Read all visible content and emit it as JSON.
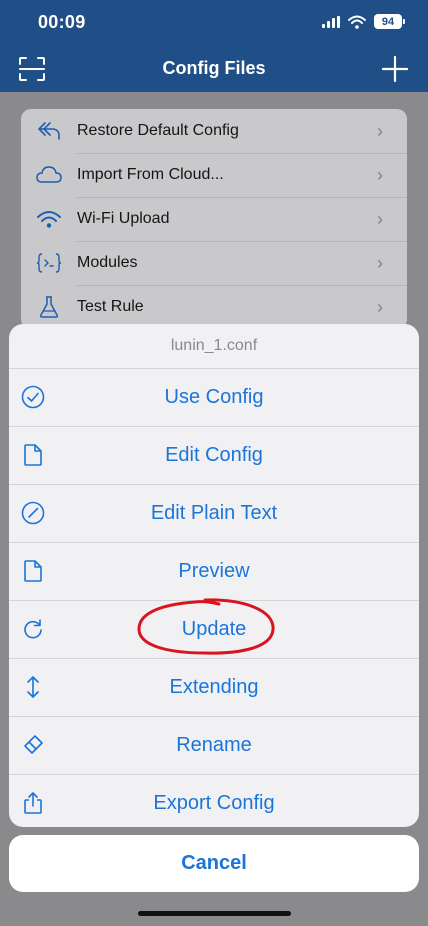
{
  "status_bar": {
    "time": "00:09",
    "battery": "94"
  },
  "header": {
    "title": "Config Files",
    "left_icon": "scan-icon",
    "right_icon": "plus-icon"
  },
  "background_list": {
    "items": [
      {
        "label": "Restore Default Config",
        "icon": "undo-arrow-icon"
      },
      {
        "label": "Import From Cloud...",
        "icon": "cloud-icon"
      },
      {
        "label": "Wi-Fi Upload",
        "icon": "wifi-icon"
      },
      {
        "label": "Modules",
        "icon": "code-braces-icon"
      },
      {
        "label": "Test Rule",
        "icon": "flask-icon"
      }
    ]
  },
  "action_sheet": {
    "title": "lunin_1.conf",
    "actions": [
      {
        "label": "Use Config",
        "icon": "checkmark-circle-icon"
      },
      {
        "label": "Edit Config",
        "icon": "document-icon"
      },
      {
        "label": "Edit Plain Text",
        "icon": "pencil-circle-icon"
      },
      {
        "label": "Preview",
        "icon": "document-icon"
      },
      {
        "label": "Update",
        "icon": "refresh-icon"
      },
      {
        "label": "Extending",
        "icon": "up-down-arrows-icon"
      },
      {
        "label": "Rename",
        "icon": "eraser-icon"
      },
      {
        "label": "Export Config",
        "icon": "share-icon"
      }
    ],
    "cancel_label": "Cancel"
  },
  "colors": {
    "nav_background": "#1f4f86",
    "accent": "#1b75d8",
    "annotation": "#d8151f"
  }
}
